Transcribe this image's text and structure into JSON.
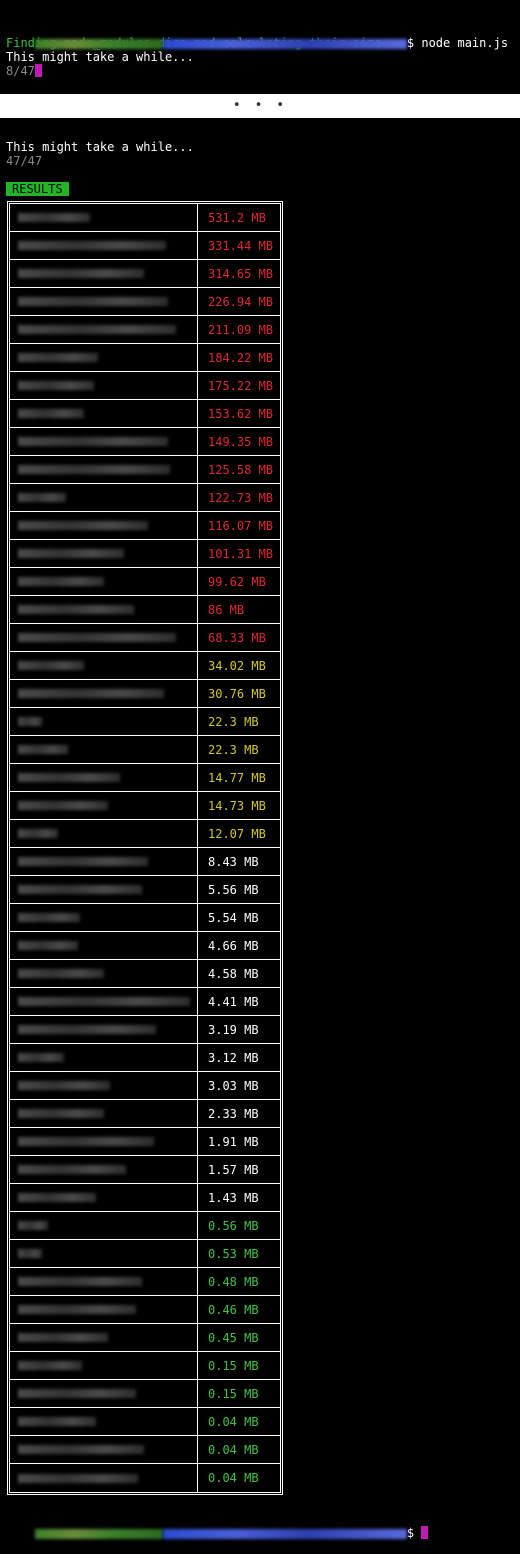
{
  "prompt": {
    "user_colors": [
      "#3b7f2a",
      "#2c4bd0",
      "#4a6a3a",
      "#3a3fb0"
    ],
    "command": "$ node main.js"
  },
  "top": {
    "status_line": "Finding node_modules dirs and calculating their size...",
    "wait_line": "This might take a while...",
    "progress": "8/47"
  },
  "divider_label": "• • •",
  "bottom": {
    "wait_line": "This might take a while...",
    "progress": "47/47",
    "results_label": "RESULTS"
  },
  "results": [
    {
      "size": "531.2 MB",
      "color": "#e02a2a"
    },
    {
      "size": "331.44 MB",
      "color": "#e02a2a"
    },
    {
      "size": "314.65 MB",
      "color": "#e02a2a"
    },
    {
      "size": "226.94 MB",
      "color": "#e02a2a"
    },
    {
      "size": "211.09 MB",
      "color": "#e02a2a"
    },
    {
      "size": "184.22 MB",
      "color": "#e02a2a"
    },
    {
      "size": "175.22 MB",
      "color": "#e02a2a"
    },
    {
      "size": "153.62 MB",
      "color": "#e02a2a"
    },
    {
      "size": "149.35 MB",
      "color": "#e02a2a"
    },
    {
      "size": "125.58 MB",
      "color": "#e02a2a"
    },
    {
      "size": "122.73 MB",
      "color": "#e02a2a"
    },
    {
      "size": "116.07 MB",
      "color": "#e02a2a"
    },
    {
      "size": "101.31 MB",
      "color": "#e02a2a"
    },
    {
      "size": "99.62 MB",
      "color": "#e02a2a"
    },
    {
      "size": "86 MB",
      "color": "#e02a2a"
    },
    {
      "size": "68.33 MB",
      "color": "#e02a2a"
    },
    {
      "size": "34.02 MB",
      "color": "#d6c72a"
    },
    {
      "size": "30.76 MB",
      "color": "#d6c72a"
    },
    {
      "size": "22.3 MB",
      "color": "#d6c72a"
    },
    {
      "size": "22.3 MB",
      "color": "#d6c72a"
    },
    {
      "size": "14.77 MB",
      "color": "#d6c72a"
    },
    {
      "size": "14.73 MB",
      "color": "#d6c72a"
    },
    {
      "size": "12.07 MB",
      "color": "#d6c72a"
    },
    {
      "size": "8.43 MB",
      "color": "#ffffff"
    },
    {
      "size": "5.56 MB",
      "color": "#ffffff"
    },
    {
      "size": "5.54 MB",
      "color": "#ffffff"
    },
    {
      "size": "4.66 MB",
      "color": "#ffffff"
    },
    {
      "size": "4.58 MB",
      "color": "#ffffff"
    },
    {
      "size": "4.41 MB",
      "color": "#ffffff"
    },
    {
      "size": "3.19 MB",
      "color": "#ffffff"
    },
    {
      "size": "3.12 MB",
      "color": "#ffffff"
    },
    {
      "size": "3.03 MB",
      "color": "#ffffff"
    },
    {
      "size": "2.33 MB",
      "color": "#ffffff"
    },
    {
      "size": "1.91 MB",
      "color": "#ffffff"
    },
    {
      "size": "1.57 MB",
      "color": "#ffffff"
    },
    {
      "size": "1.43 MB",
      "color": "#ffffff"
    },
    {
      "size": "0.56 MB",
      "color": "#3ec43e"
    },
    {
      "size": "0.53 MB",
      "color": "#3ec43e"
    },
    {
      "size": "0.48 MB",
      "color": "#3ec43e"
    },
    {
      "size": "0.46 MB",
      "color": "#3ec43e"
    },
    {
      "size": "0.45 MB",
      "color": "#3ec43e"
    },
    {
      "size": "0.15 MB",
      "color": "#3ec43e"
    },
    {
      "size": "0.15 MB",
      "color": "#3ec43e"
    },
    {
      "size": "0.04 MB",
      "color": "#3ec43e"
    },
    {
      "size": "0.04 MB",
      "color": "#3ec43e"
    },
    {
      "size": "0.04 MB",
      "color": "#3ec43e"
    }
  ],
  "final_prompt": "$"
}
